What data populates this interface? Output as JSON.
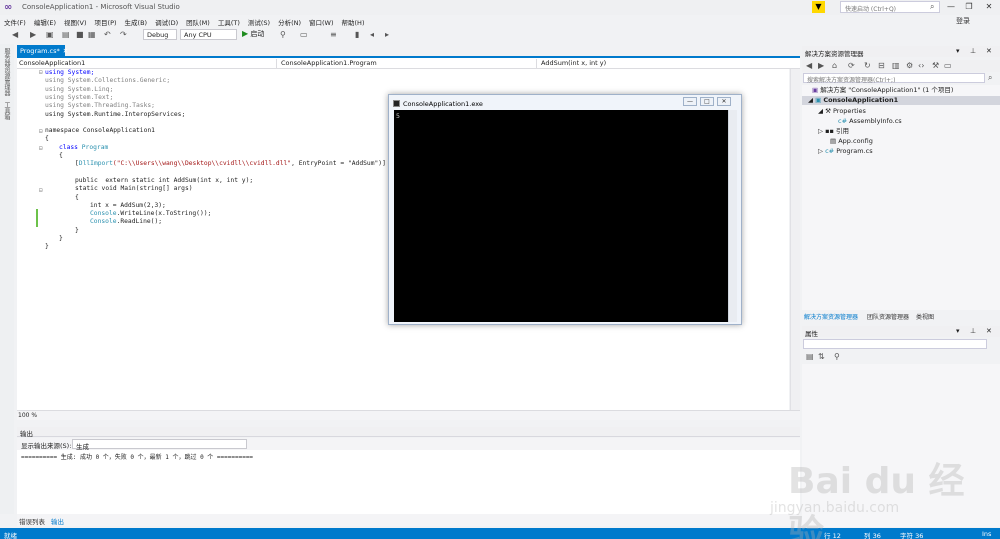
{
  "window": {
    "title": "ConsoleApplication1 - Microsoft Visual Studio",
    "quick_launch_placeholder": "快速启动 (Ctrl+Q)",
    "login": "登录",
    "minimize": "—",
    "restore": "❐",
    "close": "✕"
  },
  "menu": [
    "文件(F)",
    "编辑(E)",
    "视图(V)",
    "项目(P)",
    "生成(B)",
    "调试(D)",
    "团队(M)",
    "工具(T)",
    "测试(S)",
    "分析(N)",
    "窗口(W)",
    "帮助(H)"
  ],
  "toolbar": {
    "config": "Debug",
    "platform": "Any CPU",
    "start_label": "启动"
  },
  "left_tabs": [
    "服务器资源管理器",
    "工具箱"
  ],
  "editor": {
    "tab_label": "Program.cs*",
    "nav_project": "ConsoleApplication1",
    "nav_class": "ConsoleApplication1.Program",
    "nav_member": "AddSum(int x, int y)",
    "zoom": "100 %"
  },
  "code": {
    "l1": "using System;",
    "l2": "using System.Collections.Generic;",
    "l3": "using System.Linq;",
    "l4": "using System.Text;",
    "l5": "using System.Threading.Tasks;",
    "l6": "using System.Runtime.InteropServices;",
    "l7": "namespace ConsoleApplication1",
    "l8": "{",
    "l9_kw": "class",
    "l9_ty": "Program",
    "l10": "{",
    "l11_open": "[",
    "l11_attr": "DllImport",
    "l11_str": "(\"C:\\\\Users\\\\wang\\\\Desktop\\\\cvidll\\\\cvidll.dll\"",
    "l11_rest": ", EntryPoint = \"AddSum\")]",
    "l12": "public  extern static int AddSum(int x, int y);",
    "l13": "static void Main(string[] args)",
    "l14": "{",
    "l15": "int x = AddSum(2,3);",
    "l16_ty": "Console",
    "l16_rest": ".WriteLine(x.ToString());",
    "l17_ty": "Console",
    "l17_rest": ".ReadLine();",
    "l18": "}",
    "l19": "}",
    "l20": "}"
  },
  "output": {
    "title": "输出",
    "source_label": "显示输出来源(S):",
    "source_value": "生成",
    "text": "========== 生成: 成功 0 个，失败 0 个，最新 1 个，跳过 0 个 =========="
  },
  "bottom_tabs": [
    "错误列表",
    "输出"
  ],
  "statusbar": {
    "left": "就绪",
    "line": "行 12",
    "col": "列 36",
    "char": "字符 36",
    "mode": "Ins"
  },
  "solution_explorer": {
    "title": "解决方案资源管理器",
    "search_placeholder": "搜索解决方案资源管理器(Ctrl+;)",
    "items": [
      "解决方案 \"ConsoleApplication1\" (1 个项目)",
      "ConsoleApplication1",
      "Properties",
      "AssemblyInfo.cs",
      "引用",
      "App.config",
      "Program.cs"
    ],
    "tabs": [
      "解决方案资源管理器",
      "团队资源管理器",
      "类视图"
    ]
  },
  "properties": {
    "title": "属性"
  },
  "console": {
    "title": "ConsoleApplication1.exe",
    "output": "5",
    "minimize": "—",
    "restore": "□",
    "close": "✕"
  },
  "watermark": {
    "brand": "Bai du 经验",
    "url": "jingyan.baidu.com"
  },
  "colors": {
    "accent": "#007acc",
    "keyword": "#0000ff",
    "type": "#2b91af",
    "string": "#a31515"
  }
}
